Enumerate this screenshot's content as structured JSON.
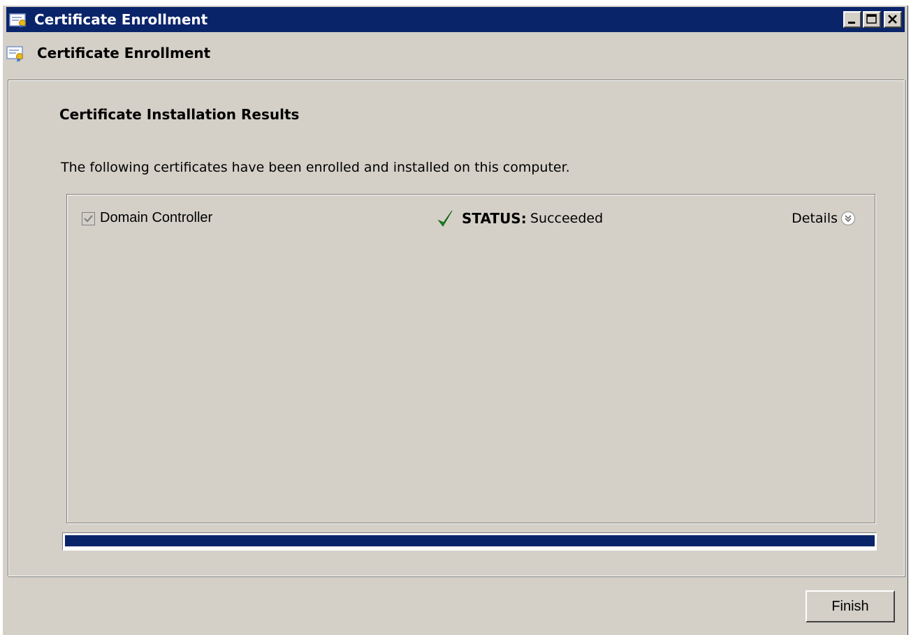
{
  "window": {
    "title": "Certificate Enrollment",
    "controls": {
      "minimize": "minimize-icon",
      "maximize": "maximize-icon",
      "close": "close-icon"
    }
  },
  "header": {
    "title": "Certificate Enrollment",
    "icon": "certificate-icon"
  },
  "page": {
    "section_title": "Certificate Installation Results",
    "description": "The following certificates have been enrolled and installed on this computer."
  },
  "certificates": [
    {
      "name": "Domain Controller",
      "checked": true,
      "status_label": "STATUS:",
      "status_value": "Succeeded",
      "status_icon": "green-checkmark-icon",
      "details_label": "Details"
    }
  ],
  "progress": {
    "percent": 100
  },
  "buttons": {
    "finish": "Finish"
  },
  "colors": {
    "titlebar": "#0a246a",
    "window_bg": "#d4d0c8",
    "progress_fill": "#0a246a",
    "status_success": "#1e8a1e"
  }
}
